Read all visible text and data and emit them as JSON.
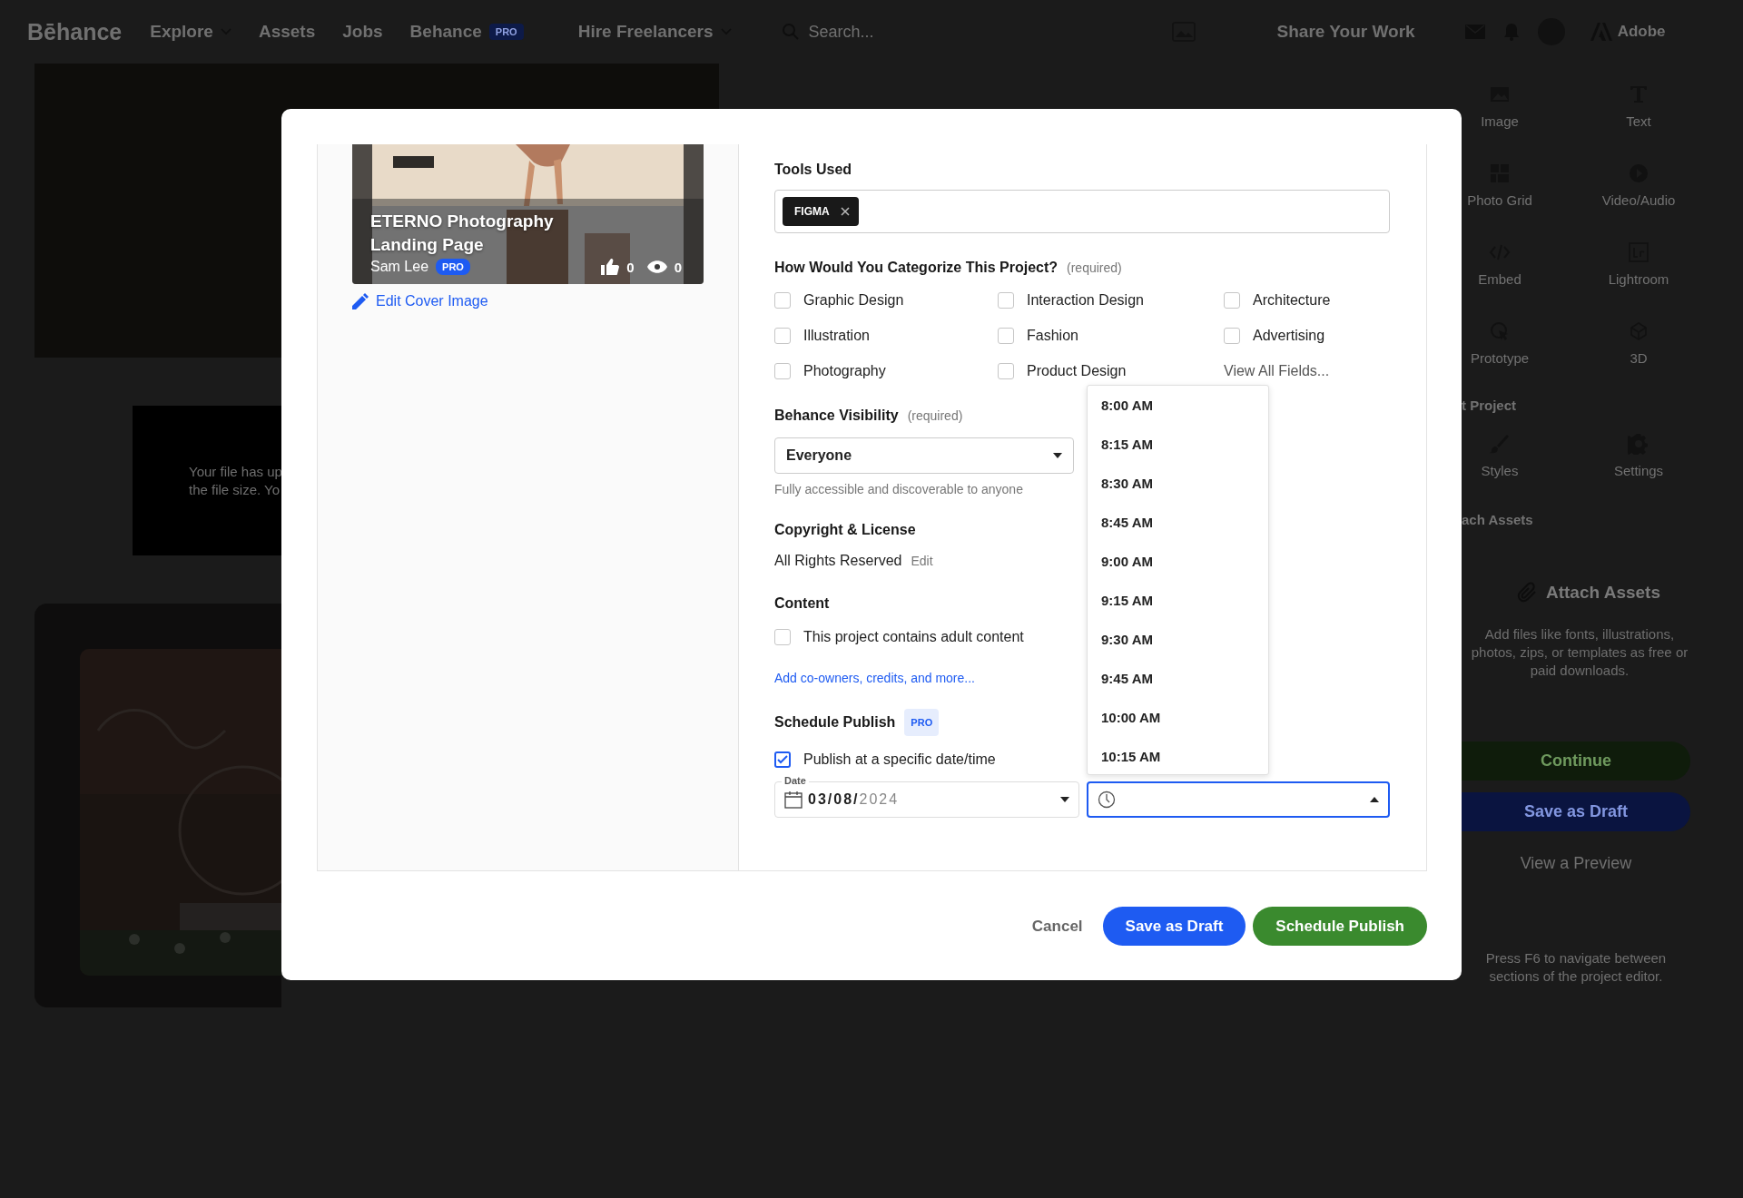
{
  "nav": {
    "logo": "Bēhance",
    "items": [
      {
        "label": "Explore",
        "kind": "menu"
      },
      {
        "label": "Assets",
        "kind": "link"
      },
      {
        "label": "Jobs",
        "kind": "link"
      },
      {
        "label": "Behance",
        "kind": "pro",
        "badge": "PRO"
      },
      {
        "label": "Hire Freelancers",
        "kind": "menu"
      }
    ],
    "search": {
      "placeholder": "Search..."
    },
    "share": "Share Your Work",
    "adobe": "Adobe"
  },
  "background": {
    "notice_lines": [
      "Your file has up",
      "the file size. Yo"
    ]
  },
  "sidebar": {
    "tools": [
      {
        "label": "Image"
      },
      {
        "label": "Text"
      },
      {
        "label": "Photo Grid"
      },
      {
        "label": "Video/Audio"
      },
      {
        "label": "Embed"
      },
      {
        "label": "Lightroom"
      },
      {
        "label": "Prototype"
      },
      {
        "label": "3D"
      }
    ],
    "section_1": "t Project",
    "settings": [
      {
        "label": "Styles"
      },
      {
        "label": "Settings"
      }
    ],
    "section_2": "ach Assets",
    "attach": {
      "title": "Attach Assets",
      "description": "Add files like fonts, illustrations, photos, zips, or templates as free or paid downloads."
    },
    "continue": "Continue",
    "draft": "Save as Draft",
    "preview": "View a Preview",
    "hint": "Press F6 to navigate between sections of the project editor."
  },
  "modal": {
    "cover": {
      "title": "ETERNO Photography Landing Page",
      "author": "Sam Lee",
      "badge": "PRO",
      "likes": "0",
      "views": "0",
      "edit_link": "Edit Cover Image"
    },
    "tools_used": {
      "label": "Tools Used",
      "chips": [
        "FIGMA"
      ]
    },
    "categories": {
      "label": "How Would You Categorize This Project?",
      "note": "(required)",
      "options": [
        {
          "label": "Graphic Design",
          "checked": false
        },
        {
          "label": "Interaction Design",
          "checked": false
        },
        {
          "label": "Architecture",
          "checked": false
        },
        {
          "label": "Illustration",
          "checked": false
        },
        {
          "label": "Fashion",
          "checked": false
        },
        {
          "label": "Advertising",
          "checked": false
        },
        {
          "label": "Photography",
          "checked": false
        },
        {
          "label": "Product Design",
          "checked": false
        }
      ],
      "more_link": "View All Fields..."
    },
    "visibility": {
      "label": "Behance Visibility",
      "note": "(required)",
      "value": "Everyone",
      "help": "Fully accessible and discoverable to anyone"
    },
    "copyright": {
      "label": "Copyright & License",
      "value": "All Rights Reserved",
      "edit": "Edit"
    },
    "content": {
      "label": "Content",
      "option": {
        "label": "This project contains adult content",
        "checked": false
      },
      "more_link": "Add co-owners, credits, and more..."
    },
    "schedule": {
      "label": "Schedule Publish",
      "badge": "PRO",
      "option": {
        "label": "Publish at a specific date/time",
        "checked": true
      },
      "date": {
        "label": "Date",
        "value": "03/08/",
        "year": "2024"
      },
      "time": {
        "expanded": true,
        "options": [
          "8:00 AM",
          "8:15 AM",
          "8:30 AM",
          "8:45 AM",
          "9:00 AM",
          "9:15 AM",
          "9:30 AM",
          "9:45 AM",
          "10:00 AM",
          "10:15 AM"
        ]
      }
    },
    "actions": {
      "cancel": "Cancel",
      "draft": "Save as Draft",
      "publish": "Schedule Publish"
    }
  }
}
